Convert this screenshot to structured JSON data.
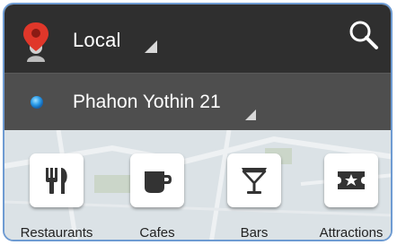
{
  "colors": {
    "action_bar": "#2f2f2f",
    "location_bar": "#4e4e4e",
    "frame_border": "#6e9bd2",
    "pin_red": "#e0372a",
    "location_dot": "#2a9be8"
  },
  "header": {
    "title": "Local",
    "logo_icon": "map-pin-person-icon",
    "search_icon": "search-icon"
  },
  "location": {
    "name": "Phahon Yothin 21",
    "status_icon": "location-dot-icon"
  },
  "categories": [
    {
      "label": "Restaurants",
      "icon": "fork-knife-icon"
    },
    {
      "label": "Cafes",
      "icon": "coffee-cup-icon"
    },
    {
      "label": "Bars",
      "icon": "cocktail-glass-icon"
    },
    {
      "label": "Attractions",
      "icon": "ticket-star-icon"
    }
  ]
}
